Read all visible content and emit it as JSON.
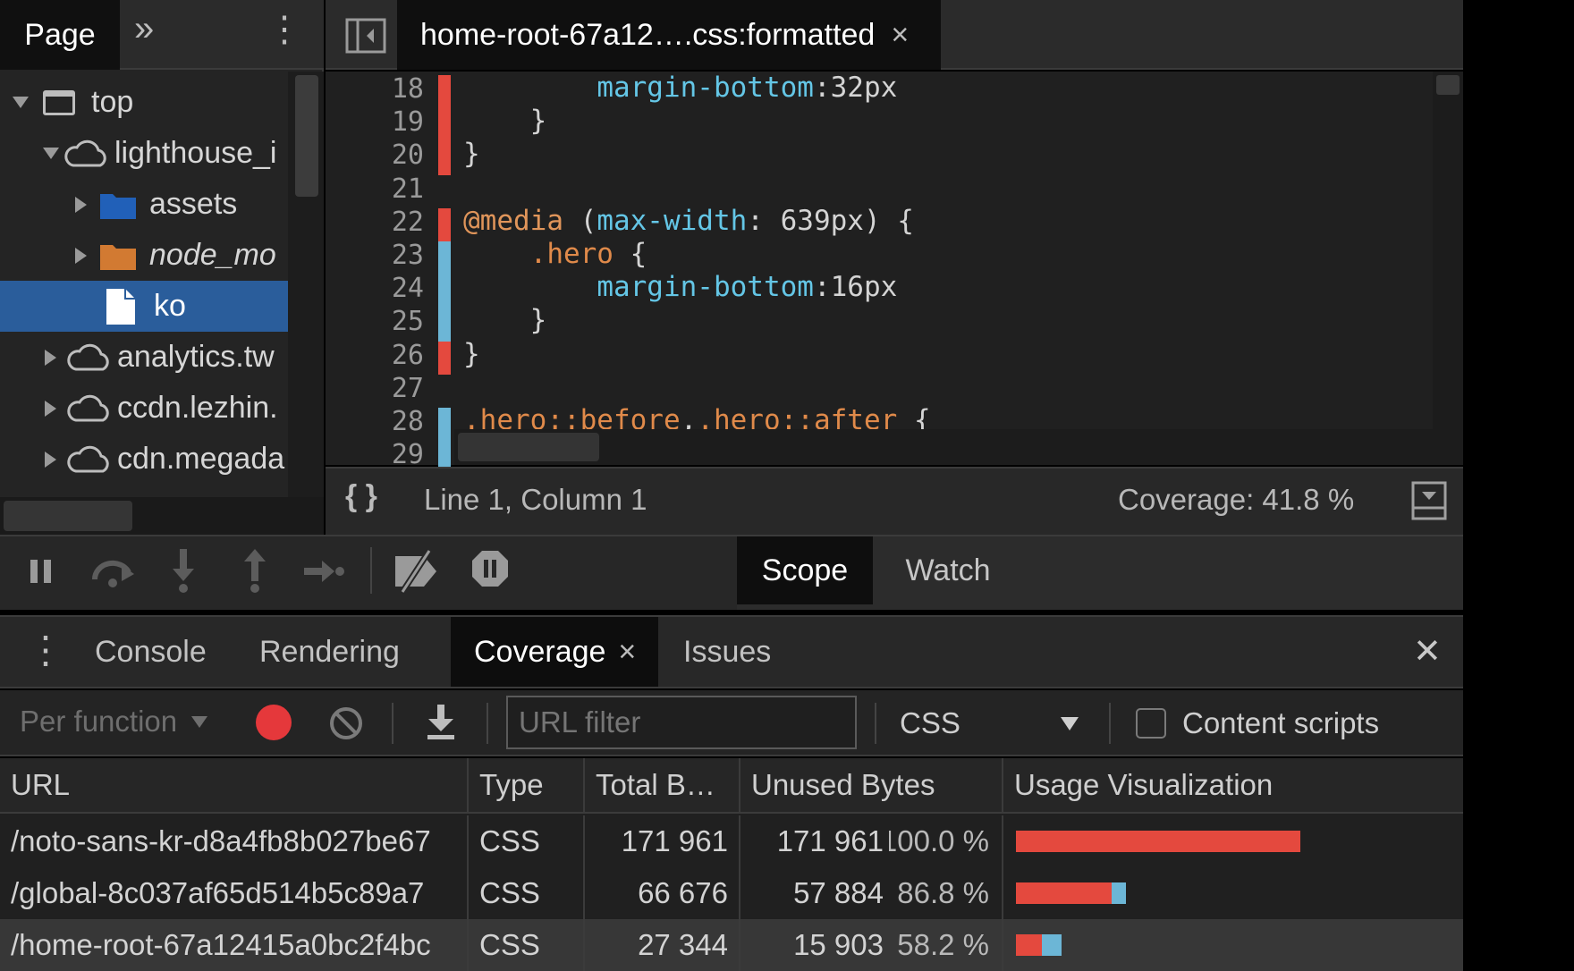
{
  "navigator": {
    "tab_label": "Page",
    "more_tabs_glyph": "»",
    "menu_glyph": "⋮",
    "tree": [
      {
        "label": "top",
        "icon": "frame-icon",
        "expanded": true
      },
      {
        "label": "lighthouse_i",
        "icon": "cloud-icon",
        "expanded": true
      },
      {
        "label": "assets",
        "icon": "folder-icon",
        "folder_color": "#2160b8"
      },
      {
        "label": "node_mo",
        "icon": "folder-icon",
        "folder_color": "#d27a32"
      },
      {
        "label": "ko",
        "icon": "file-icon",
        "selected": true
      },
      {
        "label": "analytics.tw",
        "icon": "cloud-icon"
      },
      {
        "label": "ccdn.lezhin.",
        "icon": "cloud-icon"
      },
      {
        "label": "cdn.megada",
        "icon": "cloud-icon"
      }
    ]
  },
  "editor": {
    "file_tab": "home-root-67a12….css:formatted",
    "close_glyph": "×",
    "lines": [
      {
        "n": "18",
        "code": "        margin-bottom:32px",
        "cov": "used"
      },
      {
        "n": "19",
        "code": "    }",
        "cov": "used"
      },
      {
        "n": "20",
        "code": "}",
        "cov": "used"
      },
      {
        "n": "21",
        "code": "",
        "cov": "none"
      },
      {
        "n": "22",
        "code": "@media (max-width: 639px) {",
        "cov": "used"
      },
      {
        "n": "23",
        "code": "    .hero {",
        "cov": "unused"
      },
      {
        "n": "24",
        "code": "        margin-bottom:16px",
        "cov": "unused"
      },
      {
        "n": "25",
        "code": "    }",
        "cov": "unused"
      },
      {
        "n": "26",
        "code": "}",
        "cov": "used"
      },
      {
        "n": "27",
        "code": "",
        "cov": "none"
      },
      {
        "n": "28",
        "code": ".hero::before,.hero::after {",
        "cov": "unused"
      },
      {
        "n": "29",
        "code": "",
        "cov": "unused"
      }
    ]
  },
  "status": {
    "format_glyph": "{ }",
    "position": "Line 1, Column 1",
    "coverage": "Coverage: 41.8 %"
  },
  "debugger": {
    "tabs": [
      "Scope",
      "Watch"
    ]
  },
  "drawer": {
    "menu_glyph": "⋮",
    "tabs": [
      "Console",
      "Rendering",
      "Coverage",
      "Issues"
    ],
    "active_tab": "Coverage",
    "close_tab_glyph": "×",
    "close_drawer_glyph": "✕"
  },
  "coverage_toolbar": {
    "mode": "Per function",
    "url_filter_placeholder": "URL filter",
    "type_filter": "CSS",
    "content_scripts_label": "Content scripts"
  },
  "table": {
    "columns": [
      "URL",
      "Type",
      "Total B…",
      "Unused Bytes",
      "Usage Visualization"
    ],
    "rows": [
      {
        "url": "/noto-sans-kr-d8a4fb8b027be67",
        "type": "CSS",
        "total": "171 961",
        "unused": "171 961",
        "pct": "100.0 %",
        "used_fraction": 0.0,
        "unused_fraction": 1.0,
        "scale": 1.0
      },
      {
        "url": "/global-8c037af65d514b5c89a7",
        "type": "CSS",
        "total": "66 676",
        "unused": "57 884",
        "pct": "86.8 %",
        "used_fraction": 0.132,
        "unused_fraction": 0.868,
        "scale": 0.388
      },
      {
        "url": "/home-root-67a12415a0bc2f4bc",
        "type": "CSS",
        "total": "27 344",
        "unused": "15 903",
        "pct": "58.2 %",
        "used_fraction": 0.418,
        "unused_fraction": 0.582,
        "scale": 0.159,
        "selected": true
      }
    ]
  },
  "colors": {
    "accent": "#2a5d9b",
    "used": "#6cb6d6",
    "unused": "#e4493e",
    "record": "#e5383b"
  }
}
